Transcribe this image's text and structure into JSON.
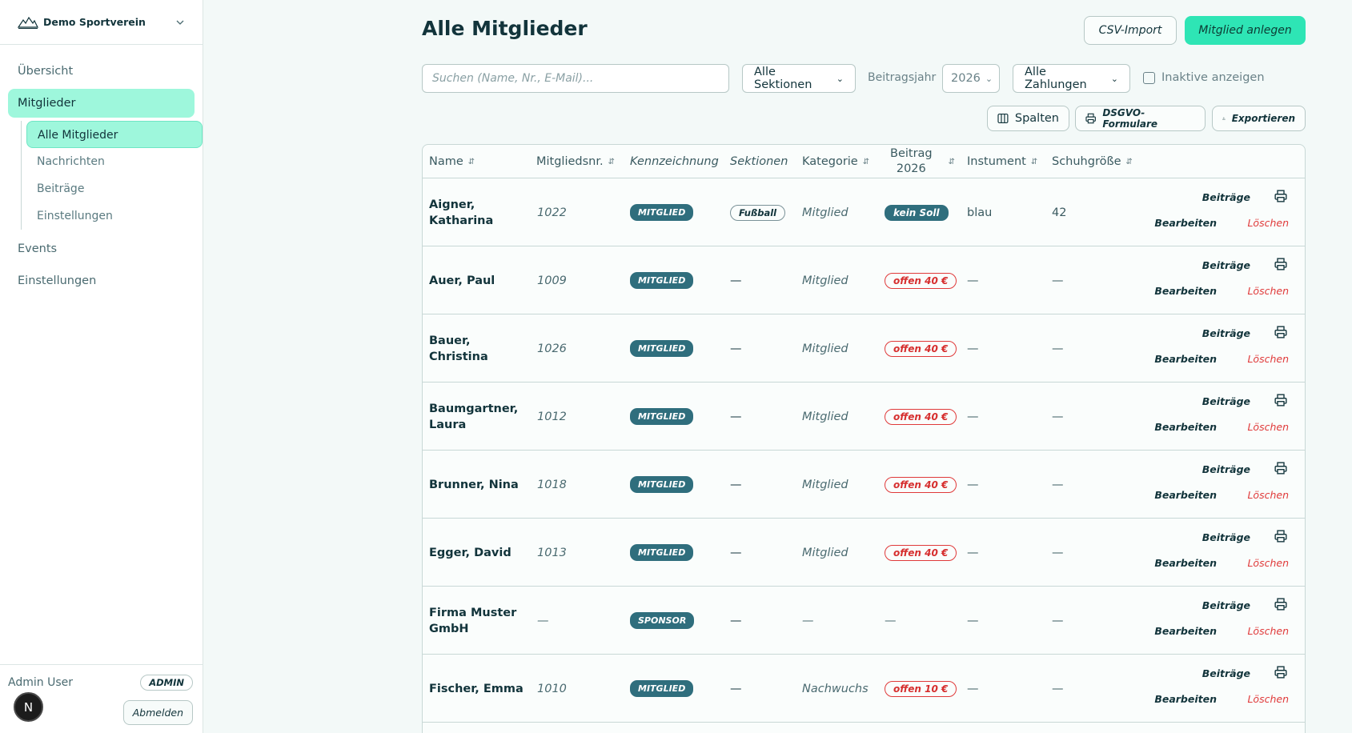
{
  "sidebar": {
    "org_name": "Demo Sportverein",
    "nav": {
      "overview": "Übersicht",
      "members": "Mitglieder",
      "sub": {
        "all": "Alle Mitglieder",
        "messages": "Nachrichten",
        "fees": "Beiträge",
        "settings": "Einstellungen"
      },
      "events": "Events",
      "settings": "Einstellungen"
    },
    "footer": {
      "user": "Admin User",
      "role": "ADMIN",
      "avatar_letter": "N",
      "logout": "Abmelden"
    }
  },
  "header": {
    "title": "Alle Mitglieder",
    "csv_import": "CSV-Import",
    "new_member": "Mitglied anlegen"
  },
  "filters": {
    "search_placeholder": "Suchen (Name, Nr., E-Mail)...",
    "sections": "Alle Sektionen",
    "year_label": "Beitragsjahr",
    "year": "2026",
    "payments": "Alle Zahlungen",
    "inactive": "Inaktive anzeigen"
  },
  "toolbar": {
    "columns": "Spalten",
    "dsgvo": "DSGVO-Formulare",
    "export": "Exportieren"
  },
  "table": {
    "headers": {
      "name": "Name",
      "nr": "Mitgliedsnr.",
      "kenn": "Kennzeichnung",
      "sekt": "Sektionen",
      "kat": "Kategorie",
      "beitrag_1": "Beitrag",
      "beitrag_2": "2026",
      "inst": "Instument",
      "schuh": "Schuhgröße"
    },
    "actions": {
      "fees": "Beiträge",
      "edit": "Bearbeiten",
      "delete": "Löschen"
    },
    "rows": [
      {
        "name": "Aigner, Katharina",
        "nr": "1022",
        "kenn": "MITGLIED",
        "sekt": "Fußball",
        "kat": "Mitglied",
        "beitrag": "kein Soll",
        "inst": "blau",
        "schuh": "42"
      },
      {
        "name": "Auer, Paul",
        "nr": "1009",
        "kenn": "MITGLIED",
        "sekt": "—",
        "kat": "Mitglied",
        "beitrag": "offen 40 €",
        "inst": "—",
        "schuh": "—"
      },
      {
        "name": "Bauer, Christina",
        "nr": "1026",
        "kenn": "MITGLIED",
        "sekt": "—",
        "kat": "Mitglied",
        "beitrag": "offen 40 €",
        "inst": "—",
        "schuh": "—"
      },
      {
        "name": "Baumgartner, Laura",
        "nr": "1012",
        "kenn": "MITGLIED",
        "sekt": "—",
        "kat": "Mitglied",
        "beitrag": "offen 40 €",
        "inst": "—",
        "schuh": "—"
      },
      {
        "name": "Brunner, Nina",
        "nr": "1018",
        "kenn": "MITGLIED",
        "sekt": "—",
        "kat": "Mitglied",
        "beitrag": "offen 40 €",
        "inst": "—",
        "schuh": "—"
      },
      {
        "name": "Egger, David",
        "nr": "1013",
        "kenn": "MITGLIED",
        "sekt": "—",
        "kat": "Mitglied",
        "beitrag": "offen 40 €",
        "inst": "—",
        "schuh": "—"
      },
      {
        "name": "Firma Muster GmbH",
        "nr": "—",
        "kenn": "SPONSOR",
        "sekt": "—",
        "kat": "—",
        "beitrag": "—",
        "inst": "—",
        "schuh": "—"
      },
      {
        "name": "Fischer, Emma",
        "nr": "1010",
        "kenn": "MITGLIED",
        "sekt": "—",
        "kat": "Nachwuchs",
        "beitrag": "offen 10 €",
        "inst": "—",
        "schuh": "—"
      }
    ]
  }
}
